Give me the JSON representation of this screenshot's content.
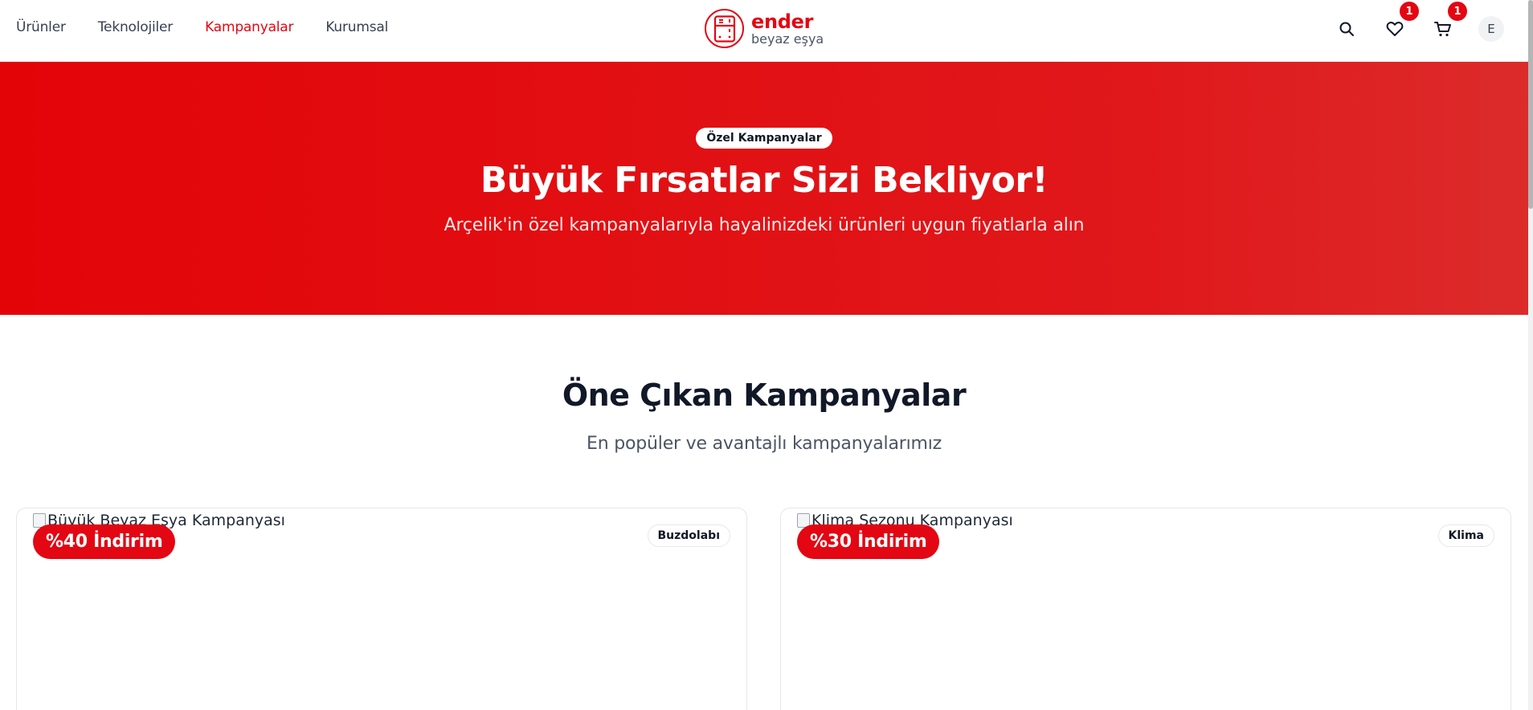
{
  "header": {
    "nav": [
      {
        "label": "Ürünler",
        "active": false
      },
      {
        "label": "Teknolojiler",
        "active": false
      },
      {
        "label": "Kampanyalar",
        "active": true
      },
      {
        "label": "Kurumsal",
        "active": false
      }
    ],
    "logo": {
      "name": "ender",
      "subtitle": "beyaz eşya",
      "icon": "fridge-icon"
    },
    "wishlist_count": "1",
    "cart_count": "1",
    "user_initial": "E"
  },
  "hero": {
    "chip": "Özel Kampanyalar",
    "title": "Büyük Fırsatlar Sizi Bekliyor!",
    "subtitle": "Arçelik'in özel kampanyalarıyla hayalinizdeki ürünleri uygun fiyatlarla alın"
  },
  "featured": {
    "title": "Öne Çıkan Kampanyalar",
    "subtitle": "En popüler ve avantajlı kampanyalarımız",
    "cards": [
      {
        "image_alt": "Büyük Beyaz Eşya Kampanyası",
        "discount": "%40 İndirim",
        "category": "Buzdolabı"
      },
      {
        "image_alt": "Klima Sezonu Kampanyası",
        "discount": "%30 İndirim",
        "category": "Klima"
      }
    ]
  },
  "colors": {
    "brand": "#e30613",
    "text_dark": "#111827",
    "text_muted": "#4b5563"
  }
}
